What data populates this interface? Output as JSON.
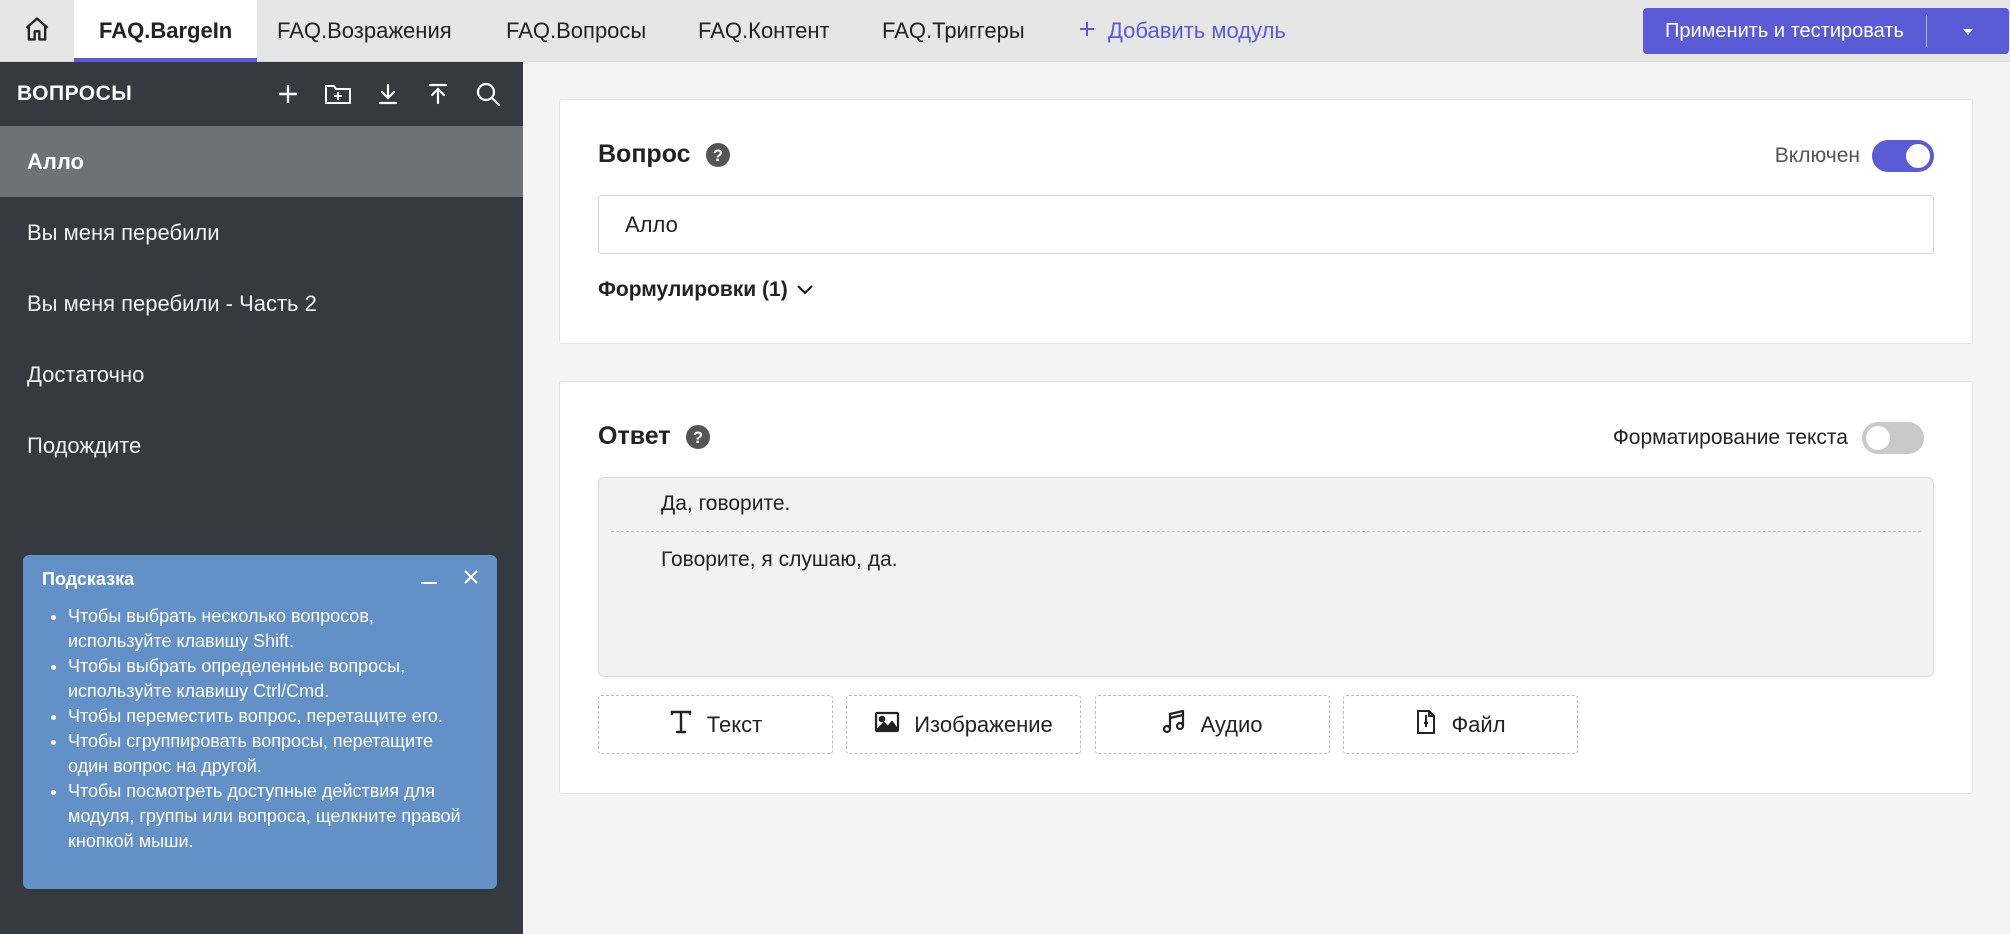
{
  "tabs": [
    {
      "label": "FAQ.BargeIn",
      "active": true
    },
    {
      "label": "FAQ.Возражения",
      "active": false
    },
    {
      "label": "FAQ.Вопросы",
      "active": false
    },
    {
      "label": "FAQ.Контент",
      "active": false
    },
    {
      "label": "FAQ.Триггеры",
      "active": false
    }
  ],
  "add_module_label": "Добавить модуль",
  "apply_button_label": "Применить и тестировать",
  "sidebar": {
    "title": "ВОПРОСЫ",
    "tool_icons": [
      "plus-icon",
      "folder-plus-icon",
      "download-icon",
      "upload-icon",
      "search-icon"
    ],
    "items": [
      {
        "label": "Алло",
        "selected": true
      },
      {
        "label": "Вы меня перебили",
        "selected": false
      },
      {
        "label": "Вы меня перебили - Часть 2",
        "selected": false
      },
      {
        "label": "Достаточно",
        "selected": false
      },
      {
        "label": "Подождите",
        "selected": false
      }
    ]
  },
  "hint": {
    "title": "Подсказка",
    "items": [
      "Чтобы выбрать несколько вопросов, используйте клавишу Shift.",
      "Чтобы выбрать определенные вопросы, используйте клавишу Ctrl/Cmd.",
      "Чтобы переместить вопрос, перетащите его.",
      "Чтобы сгруппировать вопросы, перетащите один вопрос на другой.",
      "Чтобы посмотреть доступные действия для модуля, группы или вопроса, щелкните правой кнопкой мыши."
    ]
  },
  "question": {
    "title": "Вопрос",
    "enabled_label": "Включен",
    "enabled": true,
    "value": "Алло",
    "formulations_label": "Формулировки (1)"
  },
  "answer": {
    "title": "Ответ",
    "formatting_label": "Форматирование текста",
    "formatting_enabled": false,
    "lines": [
      "Да, говорите.",
      "Говорите, я слушаю, да."
    ],
    "buttons": [
      {
        "label": "Текст",
        "icon": "text-icon"
      },
      {
        "label": "Изображение",
        "icon": "image-icon"
      },
      {
        "label": "Аудио",
        "icon": "music-icon"
      },
      {
        "label": "Файл",
        "icon": "file-icon"
      }
    ]
  },
  "colors": {
    "accent": "#5b5bd6",
    "sidebar_bg": "#343a40",
    "sidebar_selected": "#6e7276",
    "hint_bg": "#6390c6"
  }
}
